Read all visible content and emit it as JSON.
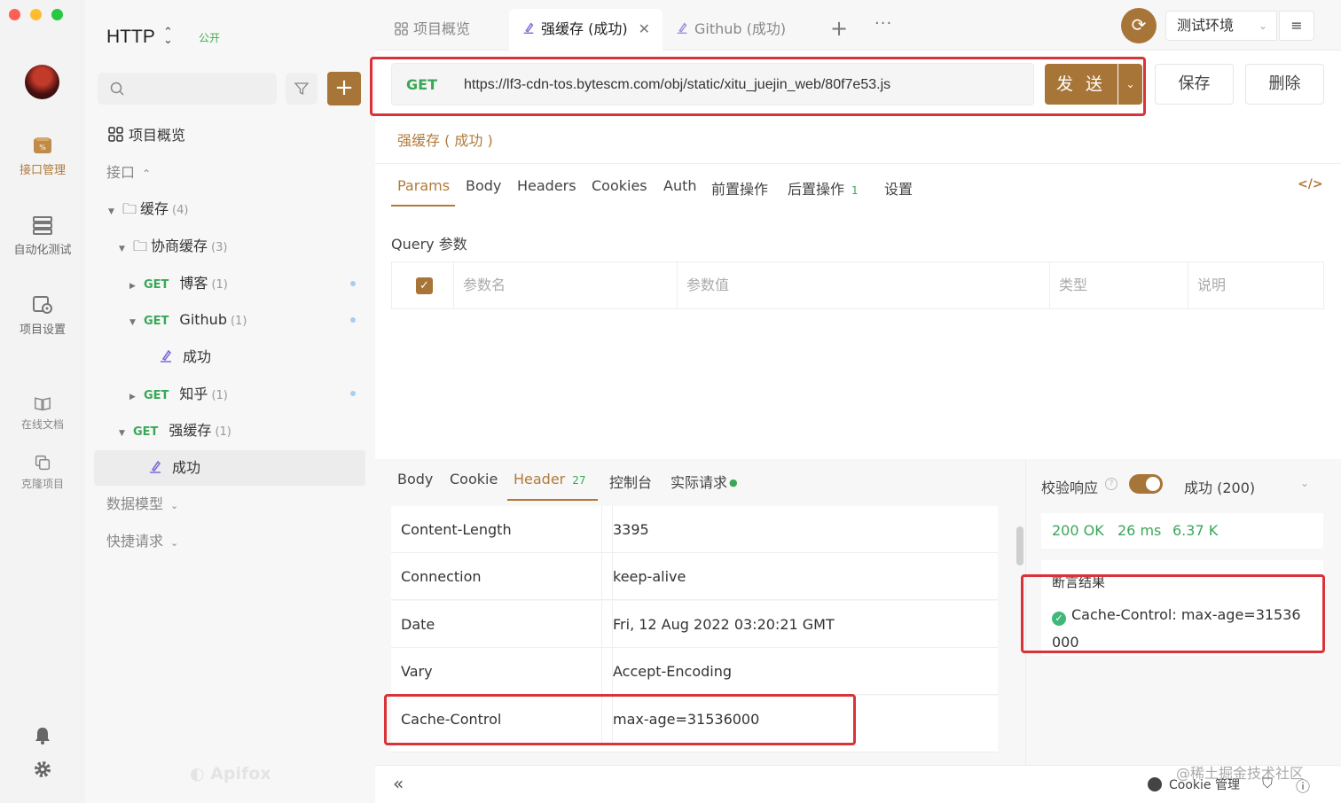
{
  "rail": {
    "items": [
      {
        "label": "接口管理",
        "icon": "api-management-icon",
        "active": true
      },
      {
        "label": "自动化测试",
        "icon": "automation-test-icon"
      },
      {
        "label": "项目设置",
        "icon": "project-settings-icon"
      },
      {
        "label": "在线文档",
        "icon": "online-docs-icon"
      },
      {
        "label": "克隆项目",
        "icon": "clone-project-icon"
      }
    ]
  },
  "sidebar": {
    "project_title": "HTTP",
    "project_badge": "公开",
    "overview": "项目概览",
    "interfaces_label": "接口",
    "tree": {
      "cache_folder": {
        "name": "缓存",
        "count": "(4)"
      },
      "negotiate_folder": {
        "name": "协商缓存",
        "count": "(3)"
      },
      "blog": {
        "method": "GET",
        "name": "博客",
        "count": "(1)"
      },
      "github": {
        "method": "GET",
        "name": "Github",
        "count": "(1)"
      },
      "github_case": "成功",
      "zhihu": {
        "method": "GET",
        "name": "知乎",
        "count": "(1)"
      },
      "strong": {
        "method": "GET",
        "name": "强缓存",
        "count": "(1)"
      },
      "strong_case": "成功"
    },
    "data_model": "数据模型",
    "quick_request": "快捷请求",
    "footer_logo": "Apifox"
  },
  "tabs": {
    "overview": "项目概览",
    "active": "强缓存 (成功)",
    "github": "Github (成功)",
    "env": "测试环境"
  },
  "request": {
    "method": "GET",
    "url": "https://lf3-cdn-tos.bytescm.com/obj/static/xitu_juejin_web/80f7e53.js",
    "send": "发 送",
    "save": "保存",
    "delete": "删除",
    "case_name": "强缓存 ( 成功 )",
    "tabs": [
      "Params",
      "Body",
      "Headers",
      "Cookies",
      "Auth",
      "前置操作",
      "后置操作",
      "设置"
    ],
    "post_ops_count": "1",
    "query_label": "Query 参数",
    "query_columns": [
      "参数名",
      "参数值",
      "类型",
      "说明"
    ]
  },
  "response": {
    "tabs": [
      "Body",
      "Cookie",
      "Header",
      "控制台",
      "实际请求"
    ],
    "header_count": "27",
    "headers": [
      {
        "key": "Content-Length",
        "value": "3395"
      },
      {
        "key": "Connection",
        "value": "keep-alive"
      },
      {
        "key": "Date",
        "value": "Fri, 12 Aug 2022 03:20:21 GMT"
      },
      {
        "key": "Vary",
        "value": "Accept-Encoding"
      },
      {
        "key": "Cache-Control",
        "value": "max-age=31536000"
      }
    ],
    "verify_label": "校验响应",
    "status_select": "成功 (200)",
    "status": "200 OK",
    "time": "26 ms",
    "size": "6.37 K",
    "assert_title": "断言结果",
    "assert_result": "Cache-Control: max-age=31536000"
  },
  "bottom": {
    "cookie_manager": "Cookie 管理",
    "watermark": "@稀土掘金技术社区"
  },
  "colors": {
    "accent": "#a87538",
    "get_method": "#3aa758",
    "highlight_box": "#d9333a"
  }
}
